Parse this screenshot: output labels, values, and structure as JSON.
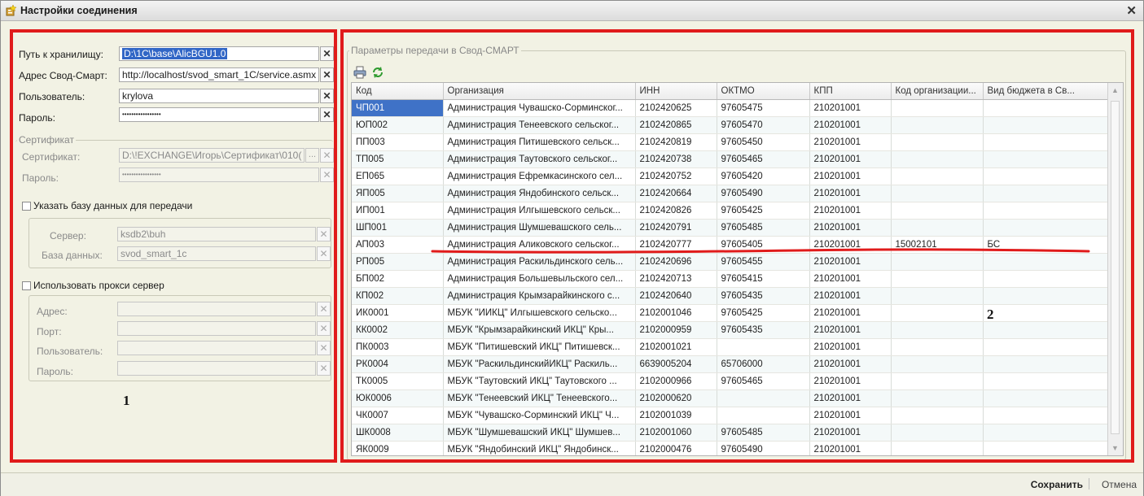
{
  "window": {
    "title": "Настройки соединения"
  },
  "left": {
    "storage_path": {
      "label": "Путь к хранилищу:",
      "value": "D:\\1C\\base\\AlicBGU1.0"
    },
    "svod_address": {
      "label": "Адрес Свод-Смарт:",
      "value": "http://localhost/svod_smart_1C/service.asmx"
    },
    "user": {
      "label": "Пользователь:",
      "value": "krylova"
    },
    "password": {
      "label": "Пароль:",
      "value": "•••••••••••••••••"
    },
    "certificate": {
      "group_title": "Сертификат",
      "cert_label": "Сертификат:",
      "cert_value": "D:\\!EXCHANGE\\Игорь\\Сертификат\\010(",
      "pass_label": "Пароль:",
      "pass_value": "•••••••••••••••••"
    },
    "db": {
      "checkbox_label": "Указать базу данных для передачи",
      "server_label": "Сервер:",
      "server_value": "ksdb2\\buh",
      "database_label": "База данных:",
      "database_value": "svod_smart_1c"
    },
    "proxy": {
      "checkbox_label": "Использовать прокси сервер",
      "address_label": "Адрес:",
      "port_label": "Порт:",
      "user_label": "Пользователь:",
      "password_label": "Пароль:"
    },
    "marker": "1"
  },
  "right": {
    "group_title": "Параметры передачи в Свод-СМАРТ",
    "marker": "2",
    "columns": [
      "Код",
      "Организация",
      "ИНН",
      "ОКТМО",
      "КПП",
      "Код организации...",
      "Вид бюджета в Св..."
    ],
    "rows": [
      [
        "ЧП001",
        "Администрация Чувашско-Сорминског...",
        "2102420625",
        "97605475",
        "210201001",
        "",
        ""
      ],
      [
        "ЮП002",
        "Администрация Тенеевского сельског...",
        "2102420865",
        "97605470",
        "210201001",
        "",
        ""
      ],
      [
        "ПП003",
        "Администрация Питишевского сельск...",
        "2102420819",
        "97605450",
        "210201001",
        "",
        ""
      ],
      [
        "ТП005",
        "Администрация Таутовского сельског...",
        "2102420738",
        "97605465",
        "210201001",
        "",
        ""
      ],
      [
        "ЕП065",
        "Администрация Ефремкасинского сел...",
        "2102420752",
        "97605420",
        "210201001",
        "",
        ""
      ],
      [
        "ЯП005",
        "Администрация Яндобинского сельск...",
        "2102420664",
        "97605490",
        "210201001",
        "",
        ""
      ],
      [
        "ИП001",
        "Администрация Илгышевского сельск...",
        "2102420826",
        "97605425",
        "210201001",
        "",
        ""
      ],
      [
        "ШП001",
        "Администрация Шумшевашского сель...",
        "2102420791",
        "97605485",
        "210201001",
        "",
        ""
      ],
      [
        "АП003",
        "Администрация Аликовского сельског...",
        "2102420777",
        "97605405",
        "210201001",
        "15002101",
        "БС"
      ],
      [
        "РП005",
        "Администрация Раскильдинского сель...",
        "2102420696",
        "97605455",
        "210201001",
        "",
        ""
      ],
      [
        "БП002",
        "Администрация Большевыльского сел...",
        "2102420713",
        "97605415",
        "210201001",
        "",
        ""
      ],
      [
        "КП002",
        "Администрация Крымзарайкинского с...",
        "2102420640",
        "97605435",
        "210201001",
        "",
        ""
      ],
      [
        "ИК0001",
        "МБУК \"ИИКЦ\" Илгышевского сельско...",
        "2102001046",
        "97605425",
        "210201001",
        "",
        ""
      ],
      [
        "КК0002",
        "МБУК \"Крымзарайкинский ИКЦ\" Кры...",
        "2102000959",
        "97605435",
        "210201001",
        "",
        ""
      ],
      [
        "ПК0003",
        "МБУК \"Питишевский ИКЦ\" Питишевск...",
        "2102001021",
        "",
        "210201001",
        "",
        ""
      ],
      [
        "РК0004",
        "МБУК \"РаскильдинскийИКЦ\" Раскиль...",
        "6639005204",
        "65706000",
        "210201001",
        "",
        ""
      ],
      [
        "ТК0005",
        "МБУК \"Таутовский ИКЦ\" Таутовского ...",
        "2102000966",
        "97605465",
        "210201001",
        "",
        ""
      ],
      [
        "ЮК0006",
        "МБУК \"Тенеевский ИКЦ\" Тенеевского...",
        "2102000620",
        "",
        "210201001",
        "",
        ""
      ],
      [
        "ЧК0007",
        "МБУК \"Чувашско-Сорминский ИКЦ\" Ч...",
        "2102001039",
        "",
        "210201001",
        "",
        ""
      ],
      [
        "ШК0008",
        "МБУК \"Шумшевашский ИКЦ\" Шумшев...",
        "2102001060",
        "97605485",
        "210201001",
        "",
        ""
      ],
      [
        "ЯК0009",
        "МБУК \"Яндобинский ИКЦ\" Яндобинск...",
        "2102000476",
        "97605490",
        "210201001",
        "",
        ""
      ]
    ]
  },
  "footer": {
    "save_label": "Сохранить",
    "cancel_label": "Отмена"
  },
  "colors": {
    "annotation_red": "#e01b1b",
    "selection_blue": "#3f72c7"
  }
}
